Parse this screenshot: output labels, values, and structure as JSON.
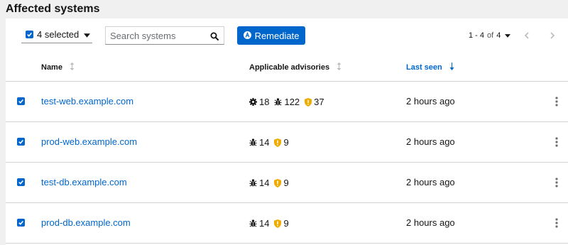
{
  "page": {
    "title": "Affected systems"
  },
  "toolbar": {
    "bulk_select_label": "4 selected",
    "search_placeholder": "Search systems",
    "remediate_label": "Remediate",
    "pagination_range": "1 - 4",
    "pagination_of": "of",
    "pagination_total": "4"
  },
  "table": {
    "columns": [
      {
        "label": "Name",
        "sorted": false
      },
      {
        "label": "Applicable advisories",
        "sorted": false
      },
      {
        "label": "Last seen",
        "sorted": true,
        "direction": "descending"
      }
    ],
    "rows": [
      {
        "name": "test-web.example.com",
        "enhancement": "18",
        "bugfix": "122",
        "security": "37",
        "last_seen": "2 hours ago",
        "selected": true
      },
      {
        "name": "prod-web.example.com",
        "bugfix": "14",
        "security": "9",
        "last_seen": "2 hours ago",
        "selected": true
      },
      {
        "name": "test-db.example.com",
        "bugfix": "14",
        "security": "9",
        "last_seen": "2 hours ago",
        "selected": true
      },
      {
        "name": "prod-db.example.com",
        "bugfix": "14",
        "security": "9",
        "last_seen": "2 hours ago",
        "selected": true
      }
    ]
  },
  "icons": {
    "enhancement": "gear-icon",
    "bugfix": "bug-icon",
    "security": "shield-icon"
  },
  "colors": {
    "accent": "#0066cc",
    "security": "#f0ab00",
    "text": "#151515",
    "page_background": "#f0f0f0"
  }
}
